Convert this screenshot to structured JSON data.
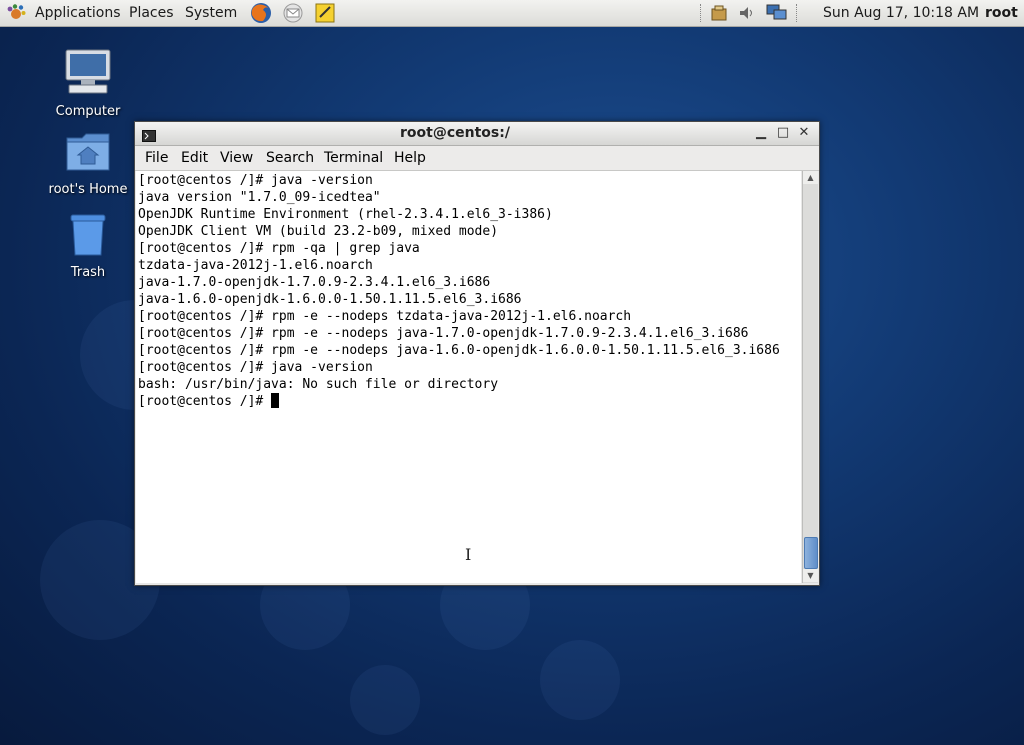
{
  "top_panel": {
    "menus": [
      "Applications",
      "Places",
      "System"
    ],
    "launchers": [
      "firefox-icon",
      "mail-icon",
      "notes-icon"
    ],
    "tray": [
      "update-icon",
      "volume-icon",
      "network-icon"
    ],
    "clock": "Sun Aug 17, 10:18 AM",
    "user": "root"
  },
  "desktop": {
    "icons": [
      {
        "label": "Computer",
        "icon": "computer-icon"
      },
      {
        "label": "root's Home",
        "icon": "home-folder-icon"
      },
      {
        "label": "Trash",
        "icon": "trash-icon"
      }
    ]
  },
  "window": {
    "title": "root@centos:/",
    "menu": [
      "File",
      "Edit",
      "View",
      "Search",
      "Terminal",
      "Help"
    ],
    "terminal_lines": [
      "[root@centos /]# java -version",
      "java version \"1.7.0_09-icedtea\"",
      "OpenJDK Runtime Environment (rhel-2.3.4.1.el6_3-i386)",
      "OpenJDK Client VM (build 23.2-b09, mixed mode)",
      "[root@centos /]# rpm -qa | grep java",
      "tzdata-java-2012j-1.el6.noarch",
      "java-1.7.0-openjdk-1.7.0.9-2.3.4.1.el6_3.i686",
      "java-1.6.0-openjdk-1.6.0.0-1.50.1.11.5.el6_3.i686",
      "[root@centos /]# rpm -e --nodeps tzdata-java-2012j-1.el6.noarch",
      "[root@centos /]# rpm -e --nodeps java-1.7.0-openjdk-1.7.0.9-2.3.4.1.el6_3.i686",
      "[root@centos /]# rpm -e --nodeps java-1.6.0-openjdk-1.6.0.0-1.50.1.11.5.el6_3.i686",
      "[root@centos /]# java -version",
      "bash: /usr/bin/java: No such file or directory",
      "[root@centos /]# "
    ]
  }
}
